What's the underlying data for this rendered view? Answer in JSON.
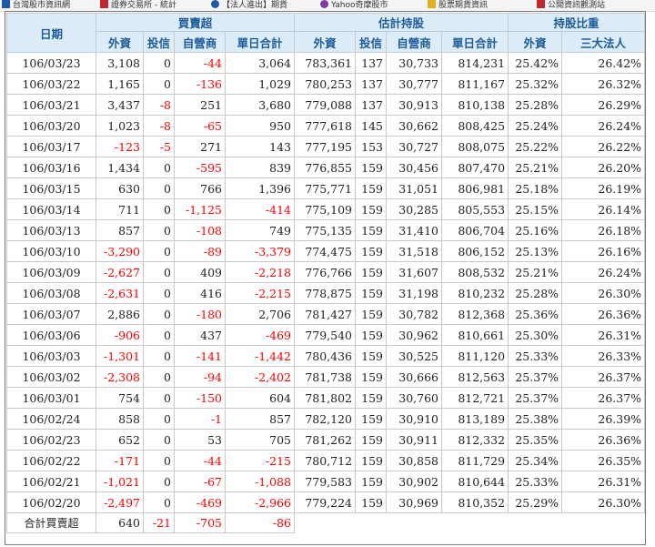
{
  "bookmarks": [
    {
      "label": "台灣股市資訊網",
      "color": "#1e5aa8"
    },
    {
      "label": "證券交易所 - 統計",
      "color": "#c0282d"
    },
    {
      "label": "【法人進出】期貨",
      "color": "#1e5aa8"
    },
    {
      "label": "Yahoo奇摩股市",
      "color": "#7b3ca8"
    },
    {
      "label": "股票期貨資訊",
      "color": "#e0b020"
    },
    {
      "label": "公開資訊觀測站",
      "color": "#c0282d"
    }
  ],
  "headers": {
    "date": "日期",
    "groups": [
      "買賣超",
      "估計持股",
      "持股比重"
    ],
    "buysell": [
      "外資",
      "投信",
      "自營商",
      "單日合計"
    ],
    "holding": [
      "外資",
      "投信",
      "自營商",
      "單日合計"
    ],
    "ratio": [
      "外資",
      "三大法人"
    ]
  },
  "rows": [
    {
      "date": "106/03/23",
      "f": "3,108",
      "t": "0",
      "d": "-44",
      "s": "3,064",
      "hf": "783,361",
      "ht": "137",
      "hd": "30,733",
      "hs": "814,231",
      "pf": "25.42%",
      "p3": "26.42%"
    },
    {
      "date": "106/03/22",
      "f": "1,165",
      "t": "0",
      "d": "-136",
      "s": "1,029",
      "hf": "780,253",
      "ht": "137",
      "hd": "30,777",
      "hs": "811,167",
      "pf": "25.32%",
      "p3": "26.32%"
    },
    {
      "date": "106/03/21",
      "f": "3,437",
      "t": "-8",
      "d": "251",
      "s": "3,680",
      "hf": "779,088",
      "ht": "137",
      "hd": "30,913",
      "hs": "810,138",
      "pf": "25.28%",
      "p3": "26.29%"
    },
    {
      "date": "106/03/20",
      "f": "1,023",
      "t": "-8",
      "d": "-65",
      "s": "950",
      "hf": "777,618",
      "ht": "145",
      "hd": "30,662",
      "hs": "808,425",
      "pf": "25.24%",
      "p3": "26.24%"
    },
    {
      "date": "106/03/17",
      "f": "-123",
      "t": "-5",
      "d": "271",
      "s": "143",
      "hf": "777,195",
      "ht": "153",
      "hd": "30,727",
      "hs": "808,075",
      "pf": "25.22%",
      "p3": "26.22%"
    },
    {
      "date": "106/03/16",
      "f": "1,434",
      "t": "0",
      "d": "-595",
      "s": "839",
      "hf": "776,855",
      "ht": "159",
      "hd": "30,456",
      "hs": "807,470",
      "pf": "25.21%",
      "p3": "26.20%"
    },
    {
      "date": "106/03/15",
      "f": "630",
      "t": "0",
      "d": "766",
      "s": "1,396",
      "hf": "775,771",
      "ht": "159",
      "hd": "31,051",
      "hs": "806,981",
      "pf": "25.18%",
      "p3": "26.19%"
    },
    {
      "date": "106/03/14",
      "f": "711",
      "t": "0",
      "d": "-1,125",
      "s": "-414",
      "hf": "775,109",
      "ht": "159",
      "hd": "30,285",
      "hs": "805,553",
      "pf": "25.15%",
      "p3": "26.14%"
    },
    {
      "date": "106/03/13",
      "f": "857",
      "t": "0",
      "d": "-108",
      "s": "749",
      "hf": "775,135",
      "ht": "159",
      "hd": "31,410",
      "hs": "806,704",
      "pf": "25.16%",
      "p3": "26.18%"
    },
    {
      "date": "106/03/10",
      "f": "-3,290",
      "t": "0",
      "d": "-89",
      "s": "-3,379",
      "hf": "774,475",
      "ht": "159",
      "hd": "31,518",
      "hs": "806,152",
      "pf": "25.13%",
      "p3": "26.16%"
    },
    {
      "date": "106/03/09",
      "f": "-2,627",
      "t": "0",
      "d": "409",
      "s": "-2,218",
      "hf": "776,766",
      "ht": "159",
      "hd": "31,607",
      "hs": "808,532",
      "pf": "25.21%",
      "p3": "26.24%"
    },
    {
      "date": "106/03/08",
      "f": "-2,631",
      "t": "0",
      "d": "416",
      "s": "-2,215",
      "hf": "778,875",
      "ht": "159",
      "hd": "31,198",
      "hs": "810,232",
      "pf": "25.28%",
      "p3": "26.30%"
    },
    {
      "date": "106/03/07",
      "f": "2,886",
      "t": "0",
      "d": "-180",
      "s": "2,706",
      "hf": "781,427",
      "ht": "159",
      "hd": "30,782",
      "hs": "812,368",
      "pf": "25.36%",
      "p3": "26.36%"
    },
    {
      "date": "106/03/06",
      "f": "-906",
      "t": "0",
      "d": "437",
      "s": "-469",
      "hf": "779,540",
      "ht": "159",
      "hd": "30,962",
      "hs": "810,661",
      "pf": "25.30%",
      "p3": "26.31%"
    },
    {
      "date": "106/03/03",
      "f": "-1,301",
      "t": "0",
      "d": "-141",
      "s": "-1,442",
      "hf": "780,436",
      "ht": "159",
      "hd": "30,525",
      "hs": "811,120",
      "pf": "25.33%",
      "p3": "26.33%"
    },
    {
      "date": "106/03/02",
      "f": "-2,308",
      "t": "0",
      "d": "-94",
      "s": "-2,402",
      "hf": "781,738",
      "ht": "159",
      "hd": "30,666",
      "hs": "812,563",
      "pf": "25.37%",
      "p3": "26.37%"
    },
    {
      "date": "106/03/01",
      "f": "754",
      "t": "0",
      "d": "-150",
      "s": "604",
      "hf": "781,802",
      "ht": "159",
      "hd": "30,760",
      "hs": "812,721",
      "pf": "25.37%",
      "p3": "26.37%"
    },
    {
      "date": "106/02/24",
      "f": "858",
      "t": "0",
      "d": "-1",
      "s": "857",
      "hf": "782,120",
      "ht": "159",
      "hd": "30,910",
      "hs": "813,189",
      "pf": "25.38%",
      "p3": "26.39%"
    },
    {
      "date": "106/02/23",
      "f": "652",
      "t": "0",
      "d": "53",
      "s": "705",
      "hf": "781,262",
      "ht": "159",
      "hd": "30,911",
      "hs": "812,332",
      "pf": "25.35%",
      "p3": "26.36%"
    },
    {
      "date": "106/02/22",
      "f": "-171",
      "t": "0",
      "d": "-44",
      "s": "-215",
      "hf": "780,712",
      "ht": "159",
      "hd": "30,858",
      "hs": "811,729",
      "pf": "25.34%",
      "p3": "26.35%"
    },
    {
      "date": "106/02/21",
      "f": "-1,021",
      "t": "0",
      "d": "-67",
      "s": "-1,088",
      "hf": "779,583",
      "ht": "159",
      "hd": "30,902",
      "hs": "810,644",
      "pf": "25.33%",
      "p3": "26.31%"
    },
    {
      "date": "106/02/20",
      "f": "-2,497",
      "t": "0",
      "d": "-469",
      "s": "-2,966",
      "hf": "779,224",
      "ht": "159",
      "hd": "30,969",
      "hs": "810,352",
      "pf": "25.29%",
      "p3": "26.30%"
    }
  ],
  "total": {
    "label": "合計買賣超",
    "f": "640",
    "t": "-21",
    "d": "-705",
    "s": "-86"
  },
  "colors": {
    "header_bg": "#dcecf8",
    "header_text": "#1d5b9a",
    "negative": "#ff0000",
    "text": "#222222"
  }
}
